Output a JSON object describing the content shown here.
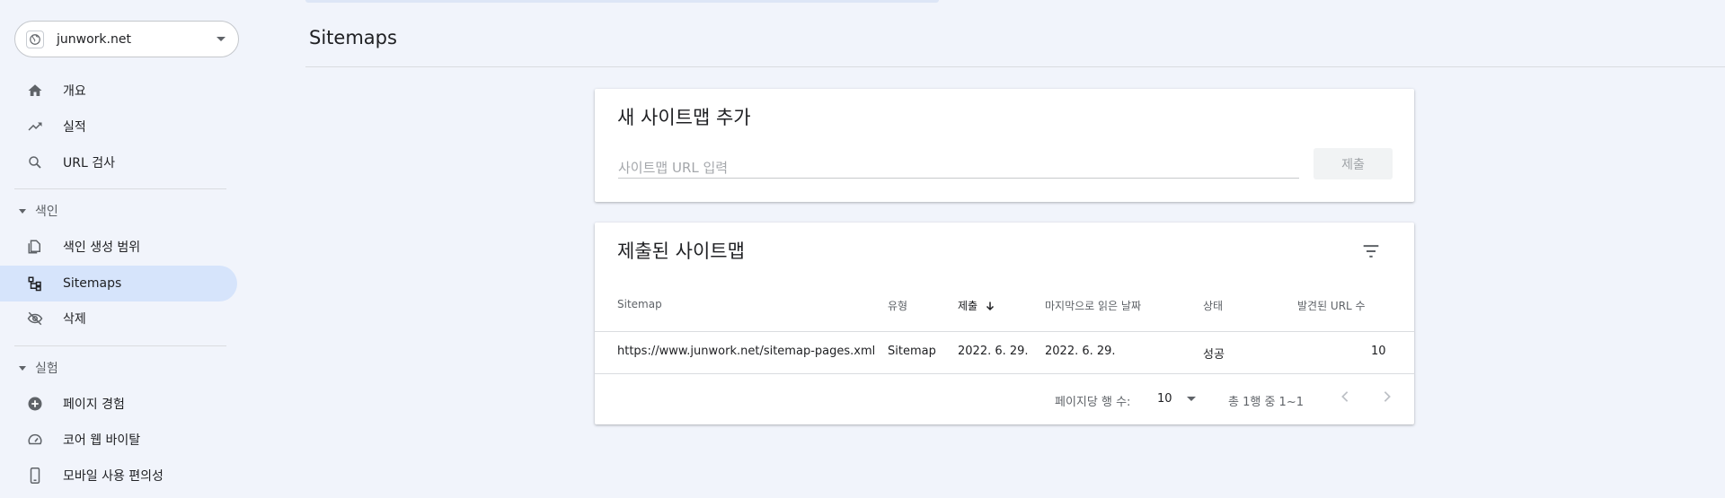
{
  "property": {
    "name": "junwork.net"
  },
  "nav": {
    "overview": "개요",
    "performance": "실적",
    "url_inspection": "URL 검사",
    "section_index": "색인",
    "coverage": "색인 생성 범위",
    "sitemaps": "Sitemaps",
    "removals": "삭제",
    "section_experience": "실험",
    "page_experience": "페이지 경험",
    "core_web_vitals": "코어 웹 바이탈",
    "mobile_usability": "모바일 사용 편의성"
  },
  "page": {
    "title": "Sitemaps"
  },
  "add_card": {
    "title": "새 사이트맵 추가",
    "input_placeholder": "사이트맵 URL 입력",
    "input_value": "",
    "submit_label": "제출"
  },
  "submitted_card": {
    "title": "제출된 사이트맵",
    "columns": {
      "sitemap": "Sitemap",
      "type": "유형",
      "submitted": "제출",
      "last_read": "마지막으로 읽은 날짜",
      "status": "상태",
      "discovered": "발견된 URL 수"
    },
    "rows": [
      {
        "sitemap": "https://www.junwork.net/sitemap-pages.xml",
        "type": "Sitemap",
        "submitted": "2022. 6. 29.",
        "last_read": "2022. 6. 29.",
        "status": "성공",
        "discovered": "10"
      }
    ],
    "footer": {
      "rows_per_page_label": "페이지당 행 수:",
      "rows_per_page_value": "10",
      "range_text": "총 1행 중 1~1"
    }
  },
  "colors": {
    "active_nav": "#d6e4fb",
    "background": "#f1f4fb",
    "success": "#202124"
  }
}
